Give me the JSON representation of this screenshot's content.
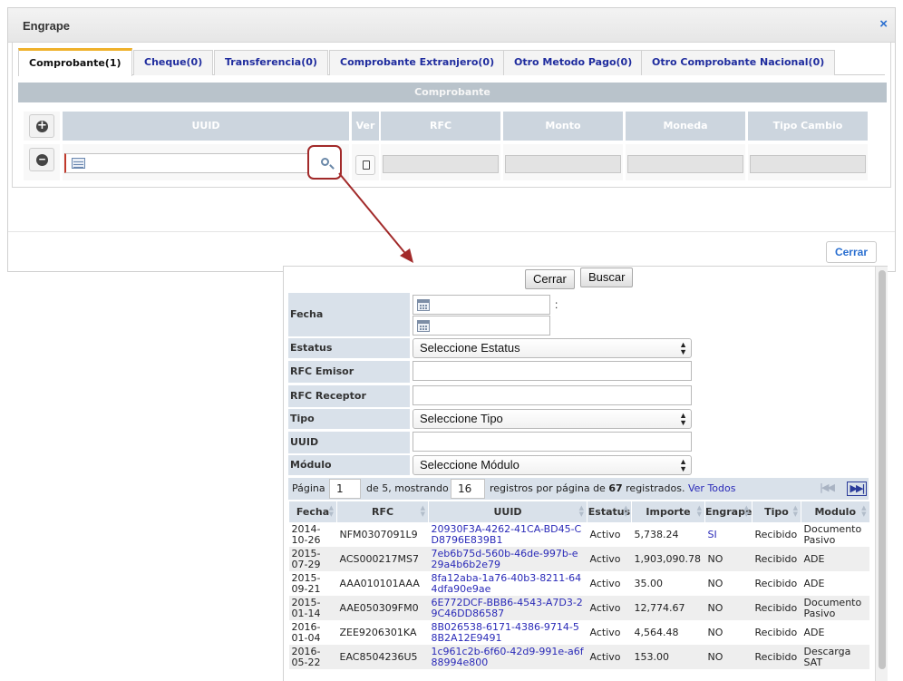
{
  "dialog": {
    "title": "Engrape",
    "close_icon": "×",
    "tabs": [
      {
        "label": "Comprobante(1)"
      },
      {
        "label": "Cheque(0)"
      },
      {
        "label": "Transferencia(0)"
      },
      {
        "label": "Comprobante Extranjero(0)"
      },
      {
        "label": "Otro Metodo Pago(0)"
      },
      {
        "label": "Otro Comprobante Nacional(0)"
      }
    ],
    "section_title": "Comprobante",
    "grid": {
      "headers": [
        "UUID",
        "Ver",
        "RFC",
        "Monto",
        "Moneda",
        "Tipo Cambio"
      ],
      "add_icon": "+",
      "remove_icon": "−"
    },
    "close_button": "Cerrar"
  },
  "lookup": {
    "close_button": "Cerrar",
    "search_button": "Buscar",
    "fecha_separator": ":",
    "filters": {
      "fecha": "Fecha",
      "estatus": "Estatus",
      "estatus_value": "Seleccione Estatus",
      "rfc_emisor": "RFC Emisor",
      "rfc_receptor": "RFC Receptor",
      "tipo": "Tipo",
      "tipo_value": "Seleccione Tipo",
      "uuid": "UUID",
      "modulo": "Módulo",
      "modulo_value": "Seleccione Módulo"
    },
    "pager": {
      "page_label": "Página",
      "page_value": "1",
      "of_label": "de 5, mostrando",
      "per_page_value": "16",
      "records_prefix": "registros por página de",
      "total": "67",
      "records_suffix": "registrados.",
      "view_all": "Ver Todos"
    },
    "columns": [
      "Fecha",
      "RFC",
      "UUID",
      "Estatus",
      "Importe",
      "Engrape",
      "Tipo",
      "Modulo"
    ],
    "rows": [
      {
        "fecha": "2014-10-26",
        "rfc": "NFM0307091L9",
        "uuid": "20930F3A-4262-41CA-BD45-CD8796E839B1",
        "estatus": "Activo",
        "importe": "5,738.24",
        "engrape": "SI",
        "tipo": "Recibido",
        "modulo": "Documento Pasivo"
      },
      {
        "fecha": "2015-07-29",
        "rfc": "ACS000217MS7",
        "uuid": "7eb6b75d-560b-46de-997b-e29a4b6b2e79",
        "estatus": "Activo",
        "importe": "1,903,090.78",
        "engrape": "NO",
        "tipo": "Recibido",
        "modulo": "ADE"
      },
      {
        "fecha": "2015-09-21",
        "rfc": "AAA010101AAA",
        "uuid": "8fa12aba-1a76-40b3-8211-644dfa90e9ae",
        "estatus": "Activo",
        "importe": "35.00",
        "engrape": "NO",
        "tipo": "Recibido",
        "modulo": "ADE"
      },
      {
        "fecha": "2015-01-14",
        "rfc": "AAE050309FM0",
        "uuid": "6E772DCF-BBB6-4543-A7D3-29C46DD86587",
        "estatus": "Activo",
        "importe": "12,774.67",
        "engrape": "NO",
        "tipo": "Recibido",
        "modulo": "Documento Pasivo"
      },
      {
        "fecha": "2016-01-04",
        "rfc": "ZEE9206301KA",
        "uuid": "8B026538-6171-4386-9714-58B2A12E9491",
        "estatus": "Activo",
        "importe": "4,564.48",
        "engrape": "NO",
        "tipo": "Recibido",
        "modulo": "ADE"
      },
      {
        "fecha": "2016-05-22",
        "rfc": "EAC8504236U5",
        "uuid": "1c961c2b-6f60-42d9-991e-a6f88994e800",
        "estatus": "Activo",
        "importe": "153.00",
        "engrape": "NO",
        "tipo": "Recibido",
        "modulo": "Descarga SAT"
      }
    ]
  },
  "colors": {
    "accent_tab": "#efb12b",
    "link": "#2a2ab8",
    "highlight": "#a22a2a",
    "header_bg": "#d9e1ea"
  }
}
